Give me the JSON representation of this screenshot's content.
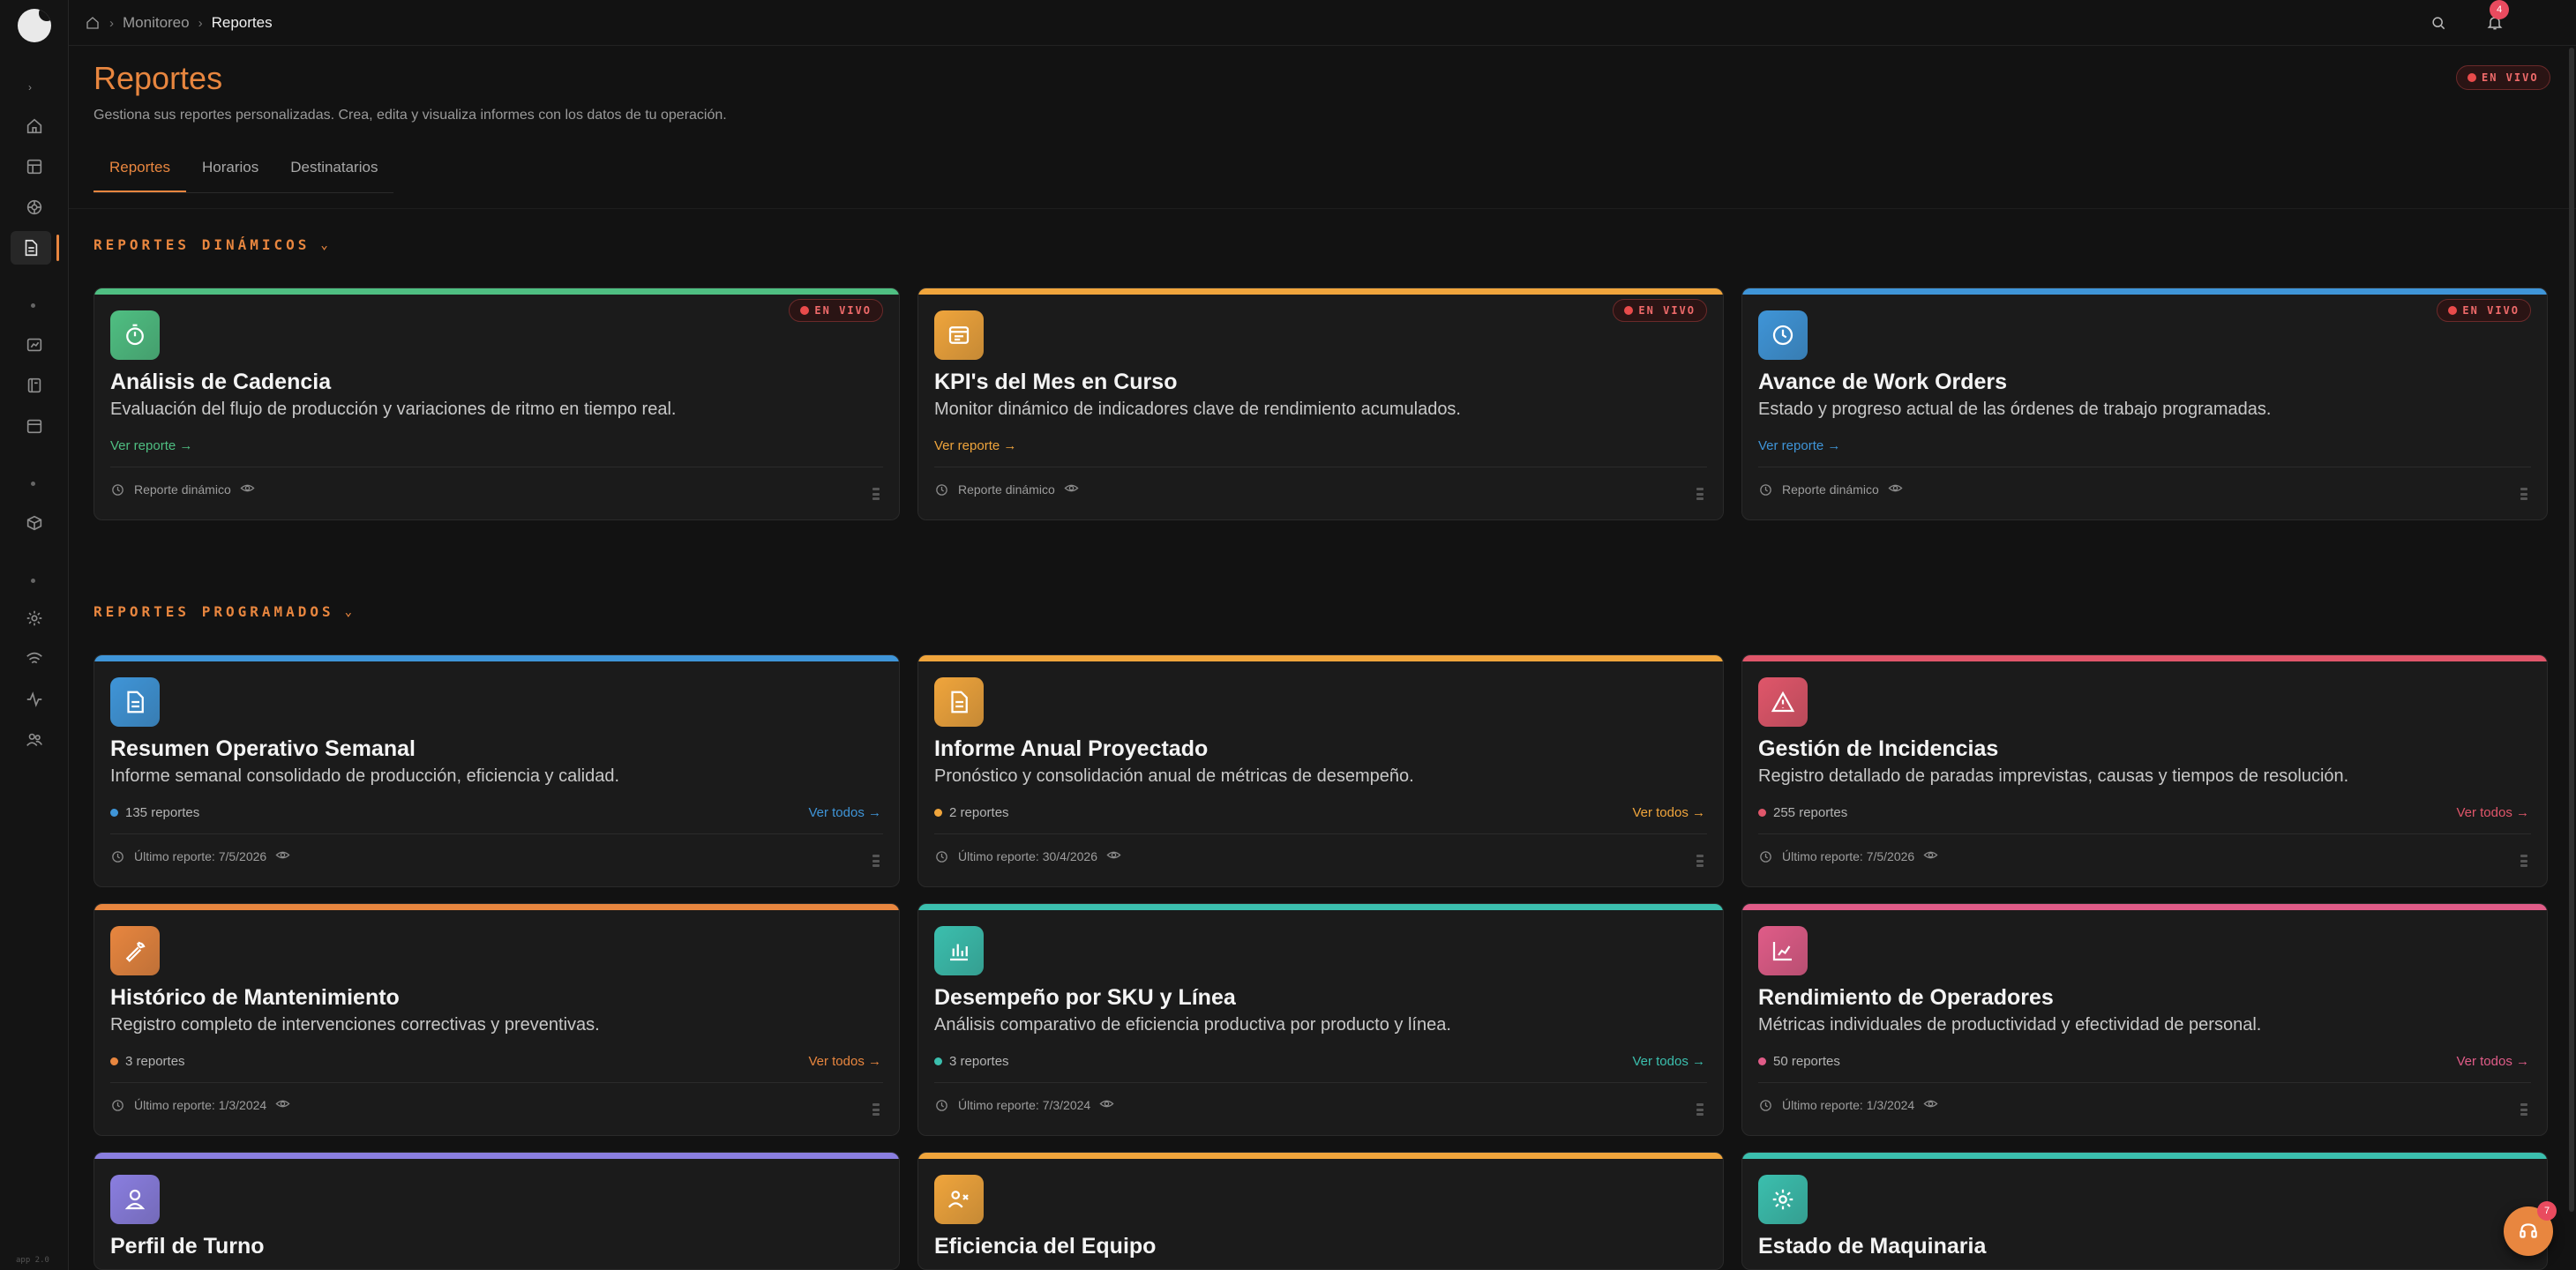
{
  "breadcrumb": {
    "home": "home",
    "items": [
      "Monitoreo",
      "Reportes"
    ]
  },
  "notifications": {
    "count": "4"
  },
  "header": {
    "title": "Reportes",
    "subtitle": "Gestiona sus reportes personalizadas. Crea, edita y visualiza informes con los datos de tu operación.",
    "live": "EN VIVO"
  },
  "tabs": [
    "Reportes",
    "Horarios",
    "Destinatarios"
  ],
  "sections": {
    "dynamic": {
      "label": "REPORTES DINÁMICOS"
    },
    "scheduled": {
      "label": "REPORTES PROGRAMADOS"
    }
  },
  "dynamic_cards": [
    {
      "title": "Análisis de Cadencia",
      "desc": "Evaluación del flujo de producción y variaciones de ritmo en tiempo real.",
      "link": "Ver reporte →",
      "footer": "Reporte dinámico",
      "live": "EN VIVO",
      "color": "#4fbf82",
      "icon": "timer-icon"
    },
    {
      "title": "KPI's del Mes en Curso",
      "desc": "Monitor dinámico de indicadores clave de rendimiento acumulados.",
      "link": "Ver reporte →",
      "footer": "Reporte dinámico",
      "live": "EN VIVO",
      "color": "#f0a53c",
      "icon": "dashboard-icon"
    },
    {
      "title": "Avance de Work Orders",
      "desc": "Estado y progreso actual de las órdenes de trabajo programadas.",
      "link": "Ver reporte →",
      "footer": "Reporte dinámico",
      "live": "EN VIVO",
      "color": "#3f95d8",
      "icon": "clock-icon"
    }
  ],
  "scheduled_cards": [
    {
      "title": "Resumen Operativo Semanal",
      "desc": "Informe semanal consolidado de producción, eficiencia y calidad.",
      "count": "135 reportes",
      "link": "Ver todos →",
      "footer": "Último reporte: 7/5/2026",
      "color": "#3f95d8",
      "icon": "document-icon"
    },
    {
      "title": "Informe Anual Proyectado",
      "desc": "Pronóstico y consolidación anual de métricas de desempeño.",
      "count": "2 reportes",
      "link": "Ver todos →",
      "footer": "Último reporte: 30/4/2026",
      "color": "#f0a53c",
      "icon": "document-icon"
    },
    {
      "title": "Gestión de Incidencias",
      "desc": "Registro detallado de paradas imprevistas, causas y tiempos de resolución.",
      "count": "255 reportes",
      "link": "Ver todos →",
      "footer": "Último reporte: 7/5/2026",
      "color": "#e0566a",
      "icon": "warning-icon"
    },
    {
      "title": "Histórico de Mantenimiento",
      "desc": "Registro completo de intervenciones correctivas y preventivas.",
      "count": "3 reportes",
      "link": "Ver todos →",
      "footer": "Último reporte: 1/3/2024",
      "color": "#e8863f",
      "icon": "wrench-icon"
    },
    {
      "title": "Desempeño por SKU y Línea",
      "desc": "Análisis comparativo de eficiencia productiva por producto y línea.",
      "count": "3 reportes",
      "link": "Ver todos →",
      "footer": "Último reporte: 7/3/2024",
      "color": "#3bbfae",
      "icon": "bar-chart-icon"
    },
    {
      "title": "Rendimiento de Operadores",
      "desc": "Métricas individuales de productividad y efectividad de personal.",
      "count": "50 reportes",
      "link": "Ver todos →",
      "footer": "Último reporte: 1/3/2024",
      "color": "#e05c88",
      "icon": "chart-icon"
    },
    {
      "title": "Perfil de Turno",
      "color": "#8a7ee0",
      "icon": "user-icon"
    },
    {
      "title": "Eficiencia del Equipo",
      "color": "#f0a53c",
      "icon": "team-icon"
    },
    {
      "title": "Estado de Maquinaria",
      "color": "#3bbfae",
      "icon": "gear-icon"
    }
  ],
  "fab": {
    "badge": "7"
  },
  "version": "app 2.0"
}
